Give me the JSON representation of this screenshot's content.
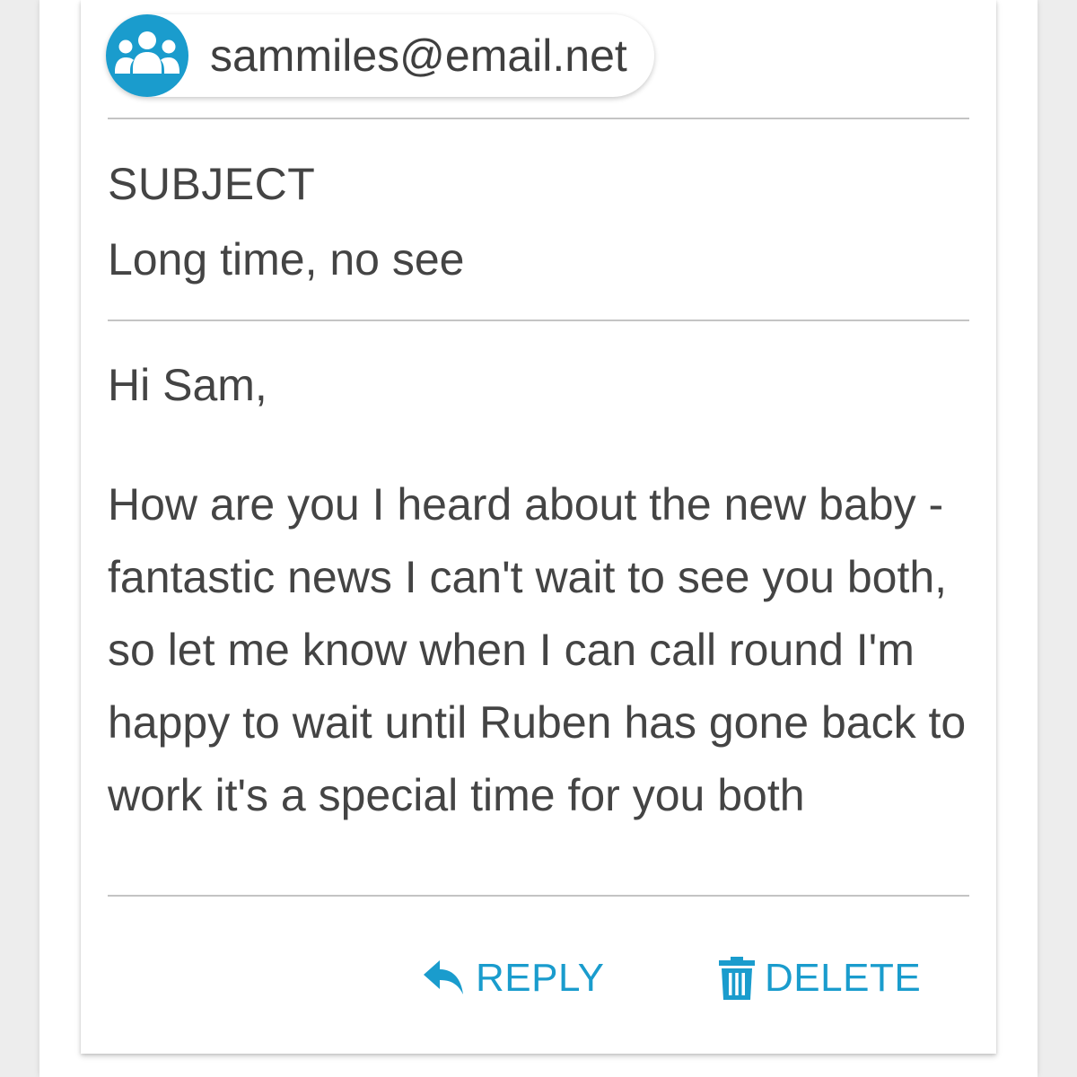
{
  "recipient": {
    "email": "sammiles@email.net",
    "avatar_icon": "group-icon"
  },
  "subject": {
    "label": "SUBJECT",
    "value": "Long time, no see"
  },
  "message": {
    "greeting": "Hi Sam,",
    "body": "How are you I heard about the new baby - fantastic news I can't wait to see you both, so let me know when I can call round I'm happy to wait until Ruben has gone back to work it's a special time for you both"
  },
  "actions": {
    "reply_label": "REPLY",
    "reply_icon": "reply-icon",
    "delete_label": "DELETE",
    "delete_icon": "trash-icon"
  },
  "colors": {
    "accent": "#1a9ccd",
    "text": "#444444",
    "divider": "#c4c4c4"
  }
}
